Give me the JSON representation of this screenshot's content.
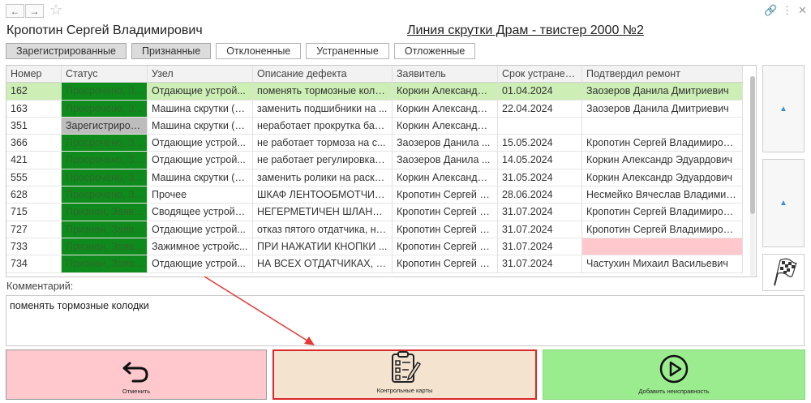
{
  "header": {
    "user_name": "Кропотин Сергей Владимирович",
    "line_title": "Линия скрутки Драм - твистер 2000 №2"
  },
  "filters": [
    "Зарегистрированные",
    "Признанные",
    "Отклоненные",
    "Устраненные",
    "Отложенные"
  ],
  "table": {
    "columns": [
      "Номер",
      "Статус",
      "Узел",
      "Описание дефекта",
      "Заявитель",
      "Срок устранения",
      "Подтвердил ремонт"
    ],
    "rows": [
      [
        "162",
        "Просрочено, З...",
        "Отдающие устрой...",
        "поменять тормозные коло...",
        "Коркин Александр ...",
        "01.04.2024",
        "Заозеров Данила Дмитриевич"
      ],
      [
        "163",
        "Просрочено, З...",
        "Машина скрутки (в...",
        "заменить подшибники на ...",
        "Коркин Александр ...",
        "22.04.2024",
        "Заозеров Данила Дмитриевич"
      ],
      [
        "351",
        "Зарегистриров...",
        "Машина скрутки (в...",
        "неработает прокрутка бар...",
        "Коркин Александр ...",
        "",
        ""
      ],
      [
        "366",
        "Просрочено, З...",
        "Отдающие устрой...",
        "не работает тормоза на с...",
        "Заозеров Данила ...",
        "15.05.2024",
        "Кропотин Сергей Владимирович"
      ],
      [
        "421",
        "Просрочено, З...",
        "Отдающие устрой...",
        "не работает регулировка н...",
        "Заозеров Данила ...",
        "14.05.2024",
        "Коркин Александр Эдуардович"
      ],
      [
        "555",
        "Просрочено, З...",
        "Машина скрутки (в...",
        "заменить ролики на раскл...",
        "Коркин Александр ...",
        "31.05.2024",
        "Коркин Александр Эдуардович"
      ],
      [
        "628",
        "Просрочено, З...",
        "Прочее",
        "ШКАФ ЛЕНТООБМОТЧИК...",
        "Кропотин Сергей В...",
        "28.06.2024",
        "Несмейко Вячеслав Владимир..."
      ],
      [
        "715",
        "Признан, Заяв...",
        "Сводящее устройс...",
        "НЕГЕРМЕТИЧЕН ШЛАНГ ...",
        "Кропотин Сергей В...",
        "31.07.2024",
        "Кропотин Сергей Владимирович"
      ],
      [
        "727",
        "Признан, Заяв...",
        "Отдающие устрой...",
        "отказ пятого отдатчика, не...",
        "Кропотин Сергей В...",
        "31.07.2024",
        "Кропотин Сергей Владимирович"
      ],
      [
        "733",
        "Признан, Заяв...",
        "Зажимное устройс...",
        "ПРИ НАЖАТИИ КНОПКИ ...",
        "Кропотин Сергей В...",
        "31.07.2024",
        ""
      ],
      [
        "734",
        "Признан, Заяв...",
        "Отдающие устрой...",
        "НА ВСЕХ ОТДАТЧИКАХ, Т...",
        "Кропотин Сергей В...",
        "31.07.2024",
        "Частухин Михаил Васильевич"
      ]
    ]
  },
  "comment": {
    "label": "Комментарий:",
    "text": "поменять тормозные колодки"
  },
  "actions": {
    "cancel": "Отменить",
    "cards": "Контрольные карты",
    "add": "Добавить неисправность"
  },
  "colors": {
    "status_green": "#0f8a1c",
    "selected_row": "#cdeeb5",
    "cancel_bg": "#ffc8cd",
    "cards_bg": "#f3e3cf",
    "add_bg": "#9bec8f",
    "highlight_border": "#d9282a"
  }
}
